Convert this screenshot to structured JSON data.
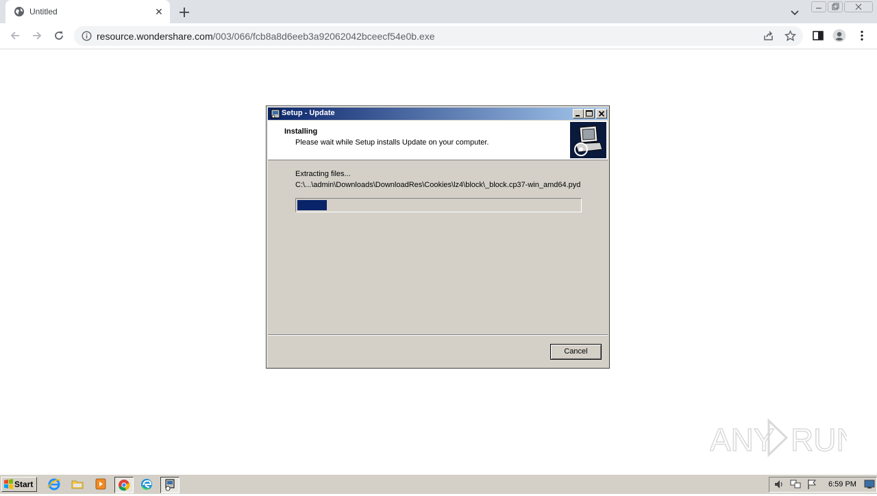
{
  "browser": {
    "tab": {
      "title": "Untitled",
      "favicon": "globe-icon",
      "close_icon": "close-icon"
    },
    "new_tab_icon": "plus-icon",
    "tab_search_icon": "chevron-down-icon",
    "nav": {
      "back_icon": "arrow-left-icon",
      "forward_icon": "arrow-right-icon",
      "reload_icon": "reload-icon"
    },
    "address": {
      "site_info_icon": "info-icon",
      "url_host": "resource.wondershare.com",
      "url_path": "/003/066/fcb8a8d6eeb3a92062042bceecf54e0b.exe"
    },
    "toolbar_icons": [
      "share-icon",
      "star-icon",
      "side-panel-icon",
      "profile-icon",
      "kebab-menu-icon"
    ]
  },
  "dialog": {
    "title": "Setup - Update",
    "header_title": "Installing",
    "header_subtitle": "Please wait while Setup installs Update on your computer.",
    "status_label": "Extracting files...",
    "file_path": "C:\\...\\admin\\Downloads\\DownloadRes\\Cookies\\lz4\\block\\_block.cp37-win_amd64.pyd",
    "progress": 0.105,
    "cancel_label": "Cancel"
  },
  "watermark": {
    "text": "ANY RUN"
  },
  "taskbar": {
    "start_label": "Start",
    "apps": [
      "ie-icon",
      "folder-icon",
      "media-player-icon",
      "chrome-icon",
      "edge-icon",
      "setup-icon"
    ],
    "tray_icons": [
      "volume-icon",
      "network-icon",
      "flag-icon"
    ],
    "clock": "6:59 PM",
    "show_desktop_icon": "desktop-icon"
  },
  "colors": {
    "titlebar_start": "#0a246a",
    "titlebar_end": "#a6caf0",
    "progress_fill": "#0a246a",
    "dialog_face": "#d4d0c8"
  }
}
